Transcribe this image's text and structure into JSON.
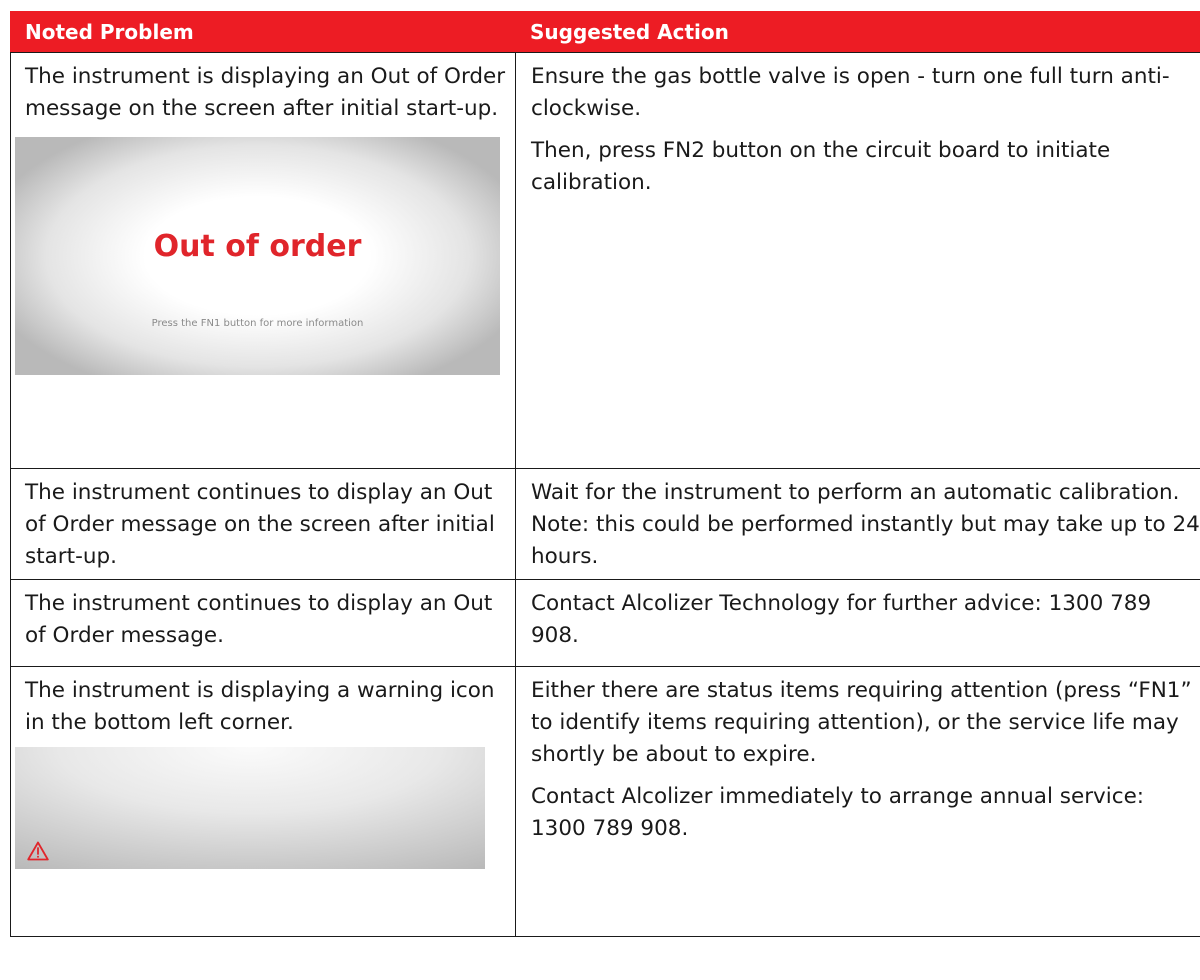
{
  "table": {
    "headers": {
      "problem": "Noted Problem",
      "action": "Suggested Action"
    },
    "rows": [
      {
        "problem": "The instrument is displaying an Out of Order message on the screen after initial start-up.",
        "actions": [
          "Ensure the gas bottle valve is open - turn one full turn anti-clockwise.",
          "Then, press FN2 button on the circuit board to initiate calibration."
        ],
        "screen": {
          "title": "Out of order",
          "subtitle": "Press the FN1 button for more information"
        }
      },
      {
        "problem": "The instrument continues to display an Out of Order message on the screen after initial start-up.",
        "actions": [
          "Wait for the instrument to perform an automatic calibration. Note: this could be performed instantly but may take up to 24 hours."
        ]
      },
      {
        "problem": "The instrument continues to display an Out of Order message.",
        "actions": [
          "Contact Alcolizer Technology for further advice: 1300 789 908."
        ]
      },
      {
        "problem": "The instrument is displaying a warning icon in the bottom left corner.",
        "actions": [
          "Either there are status items requiring attention (press “FN1” to identify items requiring attention), or the service life may shortly be about to expire.",
          "Contact Alcolizer immediately to arrange annual service: 1300 789 908."
        ],
        "screen": {
          "icon": "warning-triangle-icon"
        }
      }
    ]
  },
  "colors": {
    "header_bg": "#ed1c24",
    "header_text": "#ffffff",
    "accent_red": "#e0252b",
    "border": "#1a1a1a"
  }
}
